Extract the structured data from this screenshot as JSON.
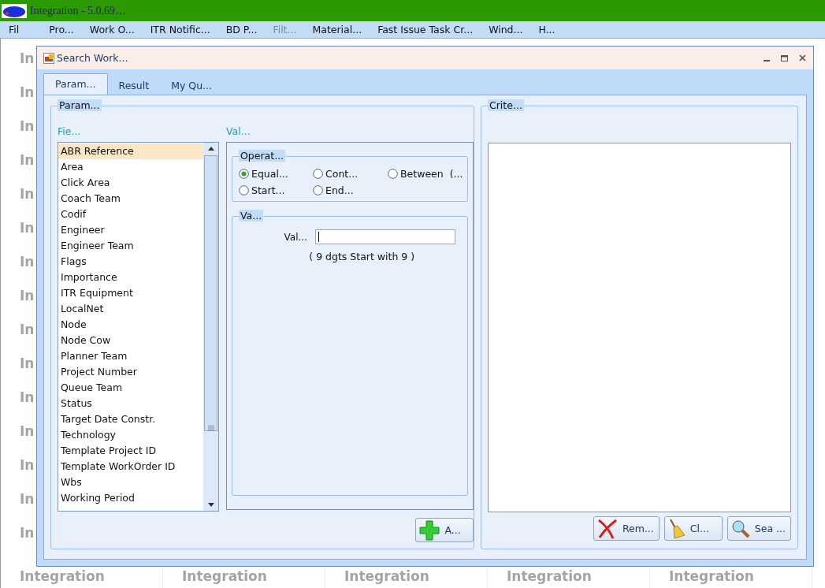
{
  "window": {
    "title": "Integration - 5.0.69…"
  },
  "menu": [
    {
      "label": "Fil",
      "disabled": false
    },
    {
      "label": "Pro...",
      "disabled": false
    },
    {
      "label": "Work O...",
      "disabled": false
    },
    {
      "label": "ITR Notific...",
      "disabled": false
    },
    {
      "label": "BD P...",
      "disabled": false
    },
    {
      "label": "Filt...",
      "disabled": true
    },
    {
      "label": "Material...",
      "disabled": false
    },
    {
      "label": "Fast Issue Task Cr...",
      "disabled": false
    },
    {
      "label": "Wind...",
      "disabled": false
    },
    {
      "label": "H...",
      "disabled": false
    }
  ],
  "background": {
    "left_fragments": [
      "In",
      "In",
      "In",
      "In",
      "In",
      "In",
      "In",
      "In",
      "In",
      "In",
      "In",
      "In",
      "In",
      "In",
      "In"
    ],
    "bottom_labels": [
      "Integration",
      "Integration",
      "Integration",
      "Integration",
      "Integration"
    ]
  },
  "dialog": {
    "title": "Search Work...",
    "tabs": [
      {
        "label": "Param...",
        "selected": true
      },
      {
        "label": "Result",
        "selected": false
      },
      {
        "label": "My Qu...",
        "selected": false
      }
    ],
    "parameters": {
      "title": "Param...",
      "fields_label": "Fie...",
      "fields": [
        {
          "label": "ABR Reference",
          "selected": true
        },
        {
          "label": "Area",
          "selected": false
        },
        {
          "label": "Click Area",
          "selected": false
        },
        {
          "label": "Coach Team",
          "selected": false
        },
        {
          "label": "Codif",
          "selected": false
        },
        {
          "label": "Engineer",
          "selected": false
        },
        {
          "label": "Engineer Team",
          "selected": false
        },
        {
          "label": "Flags",
          "selected": false
        },
        {
          "label": "Importance",
          "selected": false
        },
        {
          "label": "ITR Equipment",
          "selected": false
        },
        {
          "label": "LocalNet",
          "selected": false
        },
        {
          "label": "Node",
          "selected": false
        },
        {
          "label": "Node Cow",
          "selected": false
        },
        {
          "label": "Planner Team",
          "selected": false
        },
        {
          "label": "Project Number",
          "selected": false
        },
        {
          "label": "Queue Team",
          "selected": false
        },
        {
          "label": "Status",
          "selected": false
        },
        {
          "label": "Target Date Constr.",
          "selected": false
        },
        {
          "label": "Technology",
          "selected": false
        },
        {
          "label": "Template Project ID",
          "selected": false
        },
        {
          "label": "Template WorkOrder ID",
          "selected": false
        },
        {
          "label": "Wbs",
          "selected": false
        },
        {
          "label": "Working Period",
          "selected": false
        }
      ],
      "values_label": "Val...",
      "operators": {
        "title": "Operat...",
        "options": [
          {
            "label": "Equal...",
            "selected": true
          },
          {
            "label": "Cont...",
            "selected": false
          },
          {
            "label": "Between  (...",
            "selected": false
          },
          {
            "label": "Start...",
            "selected": false
          },
          {
            "label": "End...",
            "selected": false
          }
        ]
      },
      "value": {
        "title": "Va...",
        "field_label": "Val...",
        "hint": "( 9 dgts Start with 9 )"
      },
      "add_button": "A..."
    },
    "criteria": {
      "title": "Crite...",
      "buttons": [
        {
          "kind": "remove",
          "label": "Rem..."
        },
        {
          "kind": "clear",
          "label": "Cl..."
        },
        {
          "kind": "search",
          "label": "Sea ..."
        }
      ]
    }
  }
}
